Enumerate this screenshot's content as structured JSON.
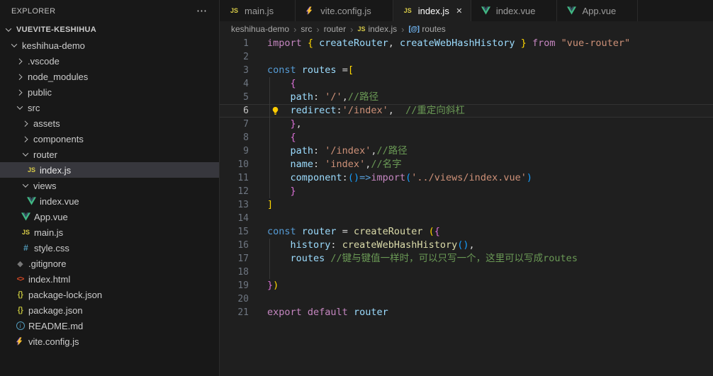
{
  "sidebar": {
    "title": "EXPLORER",
    "more_actions_glyph": "⋯",
    "tree": [
      {
        "label": "VUEVITE-KESHIHUA",
        "level": 0,
        "kind": "root",
        "expanded": true
      },
      {
        "label": "keshihua-demo",
        "level": 1,
        "kind": "folder",
        "expanded": true
      },
      {
        "label": ".vscode",
        "level": 2,
        "kind": "folder",
        "expanded": false
      },
      {
        "label": "node_modules",
        "level": 2,
        "kind": "folder",
        "expanded": false
      },
      {
        "label": "public",
        "level": 2,
        "kind": "folder",
        "expanded": false
      },
      {
        "label": "src",
        "level": 2,
        "kind": "folder",
        "expanded": true
      },
      {
        "label": "assets",
        "level": 3,
        "kind": "folder",
        "expanded": false
      },
      {
        "label": "components",
        "level": 3,
        "kind": "folder",
        "expanded": false
      },
      {
        "label": "router",
        "level": 3,
        "kind": "folder",
        "expanded": true
      },
      {
        "label": "index.js",
        "level": 4,
        "kind": "file",
        "icon": "js",
        "selected": true
      },
      {
        "label": "views",
        "level": 3,
        "kind": "folder",
        "expanded": true
      },
      {
        "label": "index.vue",
        "level": 4,
        "kind": "file",
        "icon": "vue"
      },
      {
        "label": "App.vue",
        "level": 3,
        "kind": "file",
        "icon": "vue"
      },
      {
        "label": "main.js",
        "level": 3,
        "kind": "file",
        "icon": "js"
      },
      {
        "label": "style.css",
        "level": 3,
        "kind": "file",
        "icon": "css"
      },
      {
        "label": ".gitignore",
        "level": 2,
        "kind": "file",
        "icon": "git"
      },
      {
        "label": "index.html",
        "level": 2,
        "kind": "file",
        "icon": "html"
      },
      {
        "label": "package-lock.json",
        "level": 2,
        "kind": "file",
        "icon": "json"
      },
      {
        "label": "package.json",
        "level": 2,
        "kind": "file",
        "icon": "json"
      },
      {
        "label": "README.md",
        "level": 2,
        "kind": "file",
        "icon": "readme"
      },
      {
        "label": "vite.config.js",
        "level": 2,
        "kind": "file",
        "icon": "vite"
      }
    ]
  },
  "tab_bar": {
    "close_glyph": "✕",
    "tabs": [
      {
        "label": "main.js",
        "icon": "js",
        "active": false
      },
      {
        "label": "vite.config.js",
        "icon": "vite",
        "active": false
      },
      {
        "label": "index.js",
        "icon": "js",
        "active": true
      },
      {
        "label": "index.vue",
        "icon": "vue",
        "active": false
      },
      {
        "label": "App.vue",
        "icon": "vue",
        "active": false
      }
    ]
  },
  "breadcrumb": {
    "separator": "›",
    "items": [
      {
        "label": "keshihua-demo"
      },
      {
        "label": "src"
      },
      {
        "label": "router"
      },
      {
        "label": "index.js",
        "icon": "js"
      },
      {
        "label": "routes",
        "icon": "array"
      }
    ]
  },
  "icons": {
    "js": "JS",
    "css": "#",
    "html": "<>",
    "json": "{}",
    "git": "◆",
    "readme": "i",
    "array": "[@]"
  },
  "editor": {
    "current_line": 6,
    "token_colors": {
      "kw": "#C586C0",
      "decl": "#569CD6",
      "var": "#9CDCFE",
      "fn": "#DCDCAA",
      "str": "#CE9178",
      "cmt": "#6A9955",
      "b1": "#FFD700",
      "b2": "#DA70D6",
      "b3": "#179FFF",
      "pl": "#D4D4D4"
    },
    "lines": [
      {
        "n": 1,
        "tokens": [
          [
            "import ",
            "kw"
          ],
          [
            "{ ",
            "b1"
          ],
          [
            "createRouter",
            "var"
          ],
          [
            ", ",
            "pl"
          ],
          [
            "createWebHashHistory",
            "var"
          ],
          [
            " ",
            "pl"
          ],
          [
            "}",
            "b1"
          ],
          [
            " ",
            "pl"
          ],
          [
            "from ",
            "kw"
          ],
          [
            "\"vue-router\"",
            "str"
          ]
        ]
      },
      {
        "n": 2,
        "tokens": []
      },
      {
        "n": 3,
        "tokens": [
          [
            "const ",
            "decl"
          ],
          [
            "routes ",
            "var"
          ],
          [
            "=",
            "pl"
          ],
          [
            "[",
            "b1"
          ]
        ]
      },
      {
        "n": 4,
        "guide": true,
        "tokens": [
          [
            "    ",
            "pl"
          ],
          [
            "{",
            "b2"
          ]
        ]
      },
      {
        "n": 5,
        "guide": true,
        "tokens": [
          [
            "    ",
            "pl"
          ],
          [
            "path",
            "var"
          ],
          [
            ": ",
            "pl"
          ],
          [
            "'/'",
            "str"
          ],
          [
            ",",
            "pl"
          ],
          [
            "//路径",
            "cmt"
          ]
        ]
      },
      {
        "n": 6,
        "guide": true,
        "current": true,
        "lightbulb": true,
        "tokens": [
          [
            "    ",
            "pl"
          ],
          [
            "redirect",
            "var"
          ],
          [
            ":",
            "pl"
          ],
          [
            "'/index'",
            "str"
          ],
          [
            ",  ",
            "pl"
          ],
          [
            "//重定向斜杠",
            "cmt"
          ]
        ]
      },
      {
        "n": 7,
        "guide": true,
        "tokens": [
          [
            "    ",
            "pl"
          ],
          [
            "}",
            "b2"
          ],
          [
            ",",
            "pl"
          ]
        ]
      },
      {
        "n": 8,
        "guide": true,
        "tokens": [
          [
            "    ",
            "pl"
          ],
          [
            "{",
            "b2"
          ]
        ]
      },
      {
        "n": 9,
        "guide": true,
        "tokens": [
          [
            "    ",
            "pl"
          ],
          [
            "path",
            "var"
          ],
          [
            ": ",
            "pl"
          ],
          [
            "'/index'",
            "str"
          ],
          [
            ",",
            "pl"
          ],
          [
            "//路径",
            "cmt"
          ]
        ]
      },
      {
        "n": 10,
        "guide": true,
        "tokens": [
          [
            "    ",
            "pl"
          ],
          [
            "name",
            "var"
          ],
          [
            ": ",
            "pl"
          ],
          [
            "'index'",
            "str"
          ],
          [
            ",",
            "pl"
          ],
          [
            "//名字",
            "cmt"
          ]
        ]
      },
      {
        "n": 11,
        "guide": true,
        "tokens": [
          [
            "    ",
            "pl"
          ],
          [
            "component",
            "var"
          ],
          [
            ":",
            "pl"
          ],
          [
            "(",
            "b3"
          ],
          [
            ")",
            "b3"
          ],
          [
            "=>",
            "decl"
          ],
          [
            "import",
            "kw"
          ],
          [
            "(",
            "b3"
          ],
          [
            "'../views/index.vue'",
            "str"
          ],
          [
            ")",
            "b3"
          ]
        ]
      },
      {
        "n": 12,
        "guide": true,
        "tokens": [
          [
            "    ",
            "pl"
          ],
          [
            "}",
            "b2"
          ]
        ]
      },
      {
        "n": 13,
        "tokens": [
          [
            "]",
            "b1"
          ]
        ]
      },
      {
        "n": 14,
        "tokens": []
      },
      {
        "n": 15,
        "tokens": [
          [
            "const ",
            "decl"
          ],
          [
            "router ",
            "var"
          ],
          [
            "= ",
            "pl"
          ],
          [
            "createRouter ",
            "fn"
          ],
          [
            "(",
            "b1"
          ],
          [
            "{",
            "b2"
          ]
        ]
      },
      {
        "n": 16,
        "guide": true,
        "tokens": [
          [
            "    ",
            "pl"
          ],
          [
            "history",
            "var"
          ],
          [
            ": ",
            "pl"
          ],
          [
            "createWebHashHistory",
            "fn"
          ],
          [
            "(",
            "b3"
          ],
          [
            ")",
            "b3"
          ],
          [
            ",",
            "pl"
          ]
        ]
      },
      {
        "n": 17,
        "guide": true,
        "tokens": [
          [
            "    ",
            "pl"
          ],
          [
            "routes ",
            "var"
          ],
          [
            "//键与键值一样时，可以只写一个，这里可以写成routes",
            "cmt"
          ]
        ]
      },
      {
        "n": 18,
        "guide": true,
        "tokens": []
      },
      {
        "n": 19,
        "tokens": [
          [
            "}",
            "b2"
          ],
          [
            ")",
            "b1"
          ]
        ]
      },
      {
        "n": 20,
        "tokens": []
      },
      {
        "n": 21,
        "tokens": [
          [
            "export ",
            "kw"
          ],
          [
            "default ",
            "kw"
          ],
          [
            "router",
            "var"
          ]
        ]
      }
    ]
  },
  "colors": {
    "editor_bg": "#1f1f1f",
    "sidebar_bg": "#181818",
    "tab_bar_bg": "#181818",
    "active_tab_bg": "#1f1f1f",
    "selected_item_bg": "#37373d",
    "border": "#2b2b2b",
    "line_number": "#6e7681",
    "active_line_number": "#c6c6c6",
    "js_icon": "#d8cb48",
    "vue_green": "#41b883",
    "vite_yellow": "#fdc228",
    "css_blue": "#519aba",
    "html_orange": "#dc4a25",
    "json_yellow": "#b7b73b",
    "readme_blue": "#519aba",
    "lightbulb": "#ffcc00",
    "breadcrumb_fg": "#a9a9a9",
    "symbol_array_blue": "#75beff"
  }
}
